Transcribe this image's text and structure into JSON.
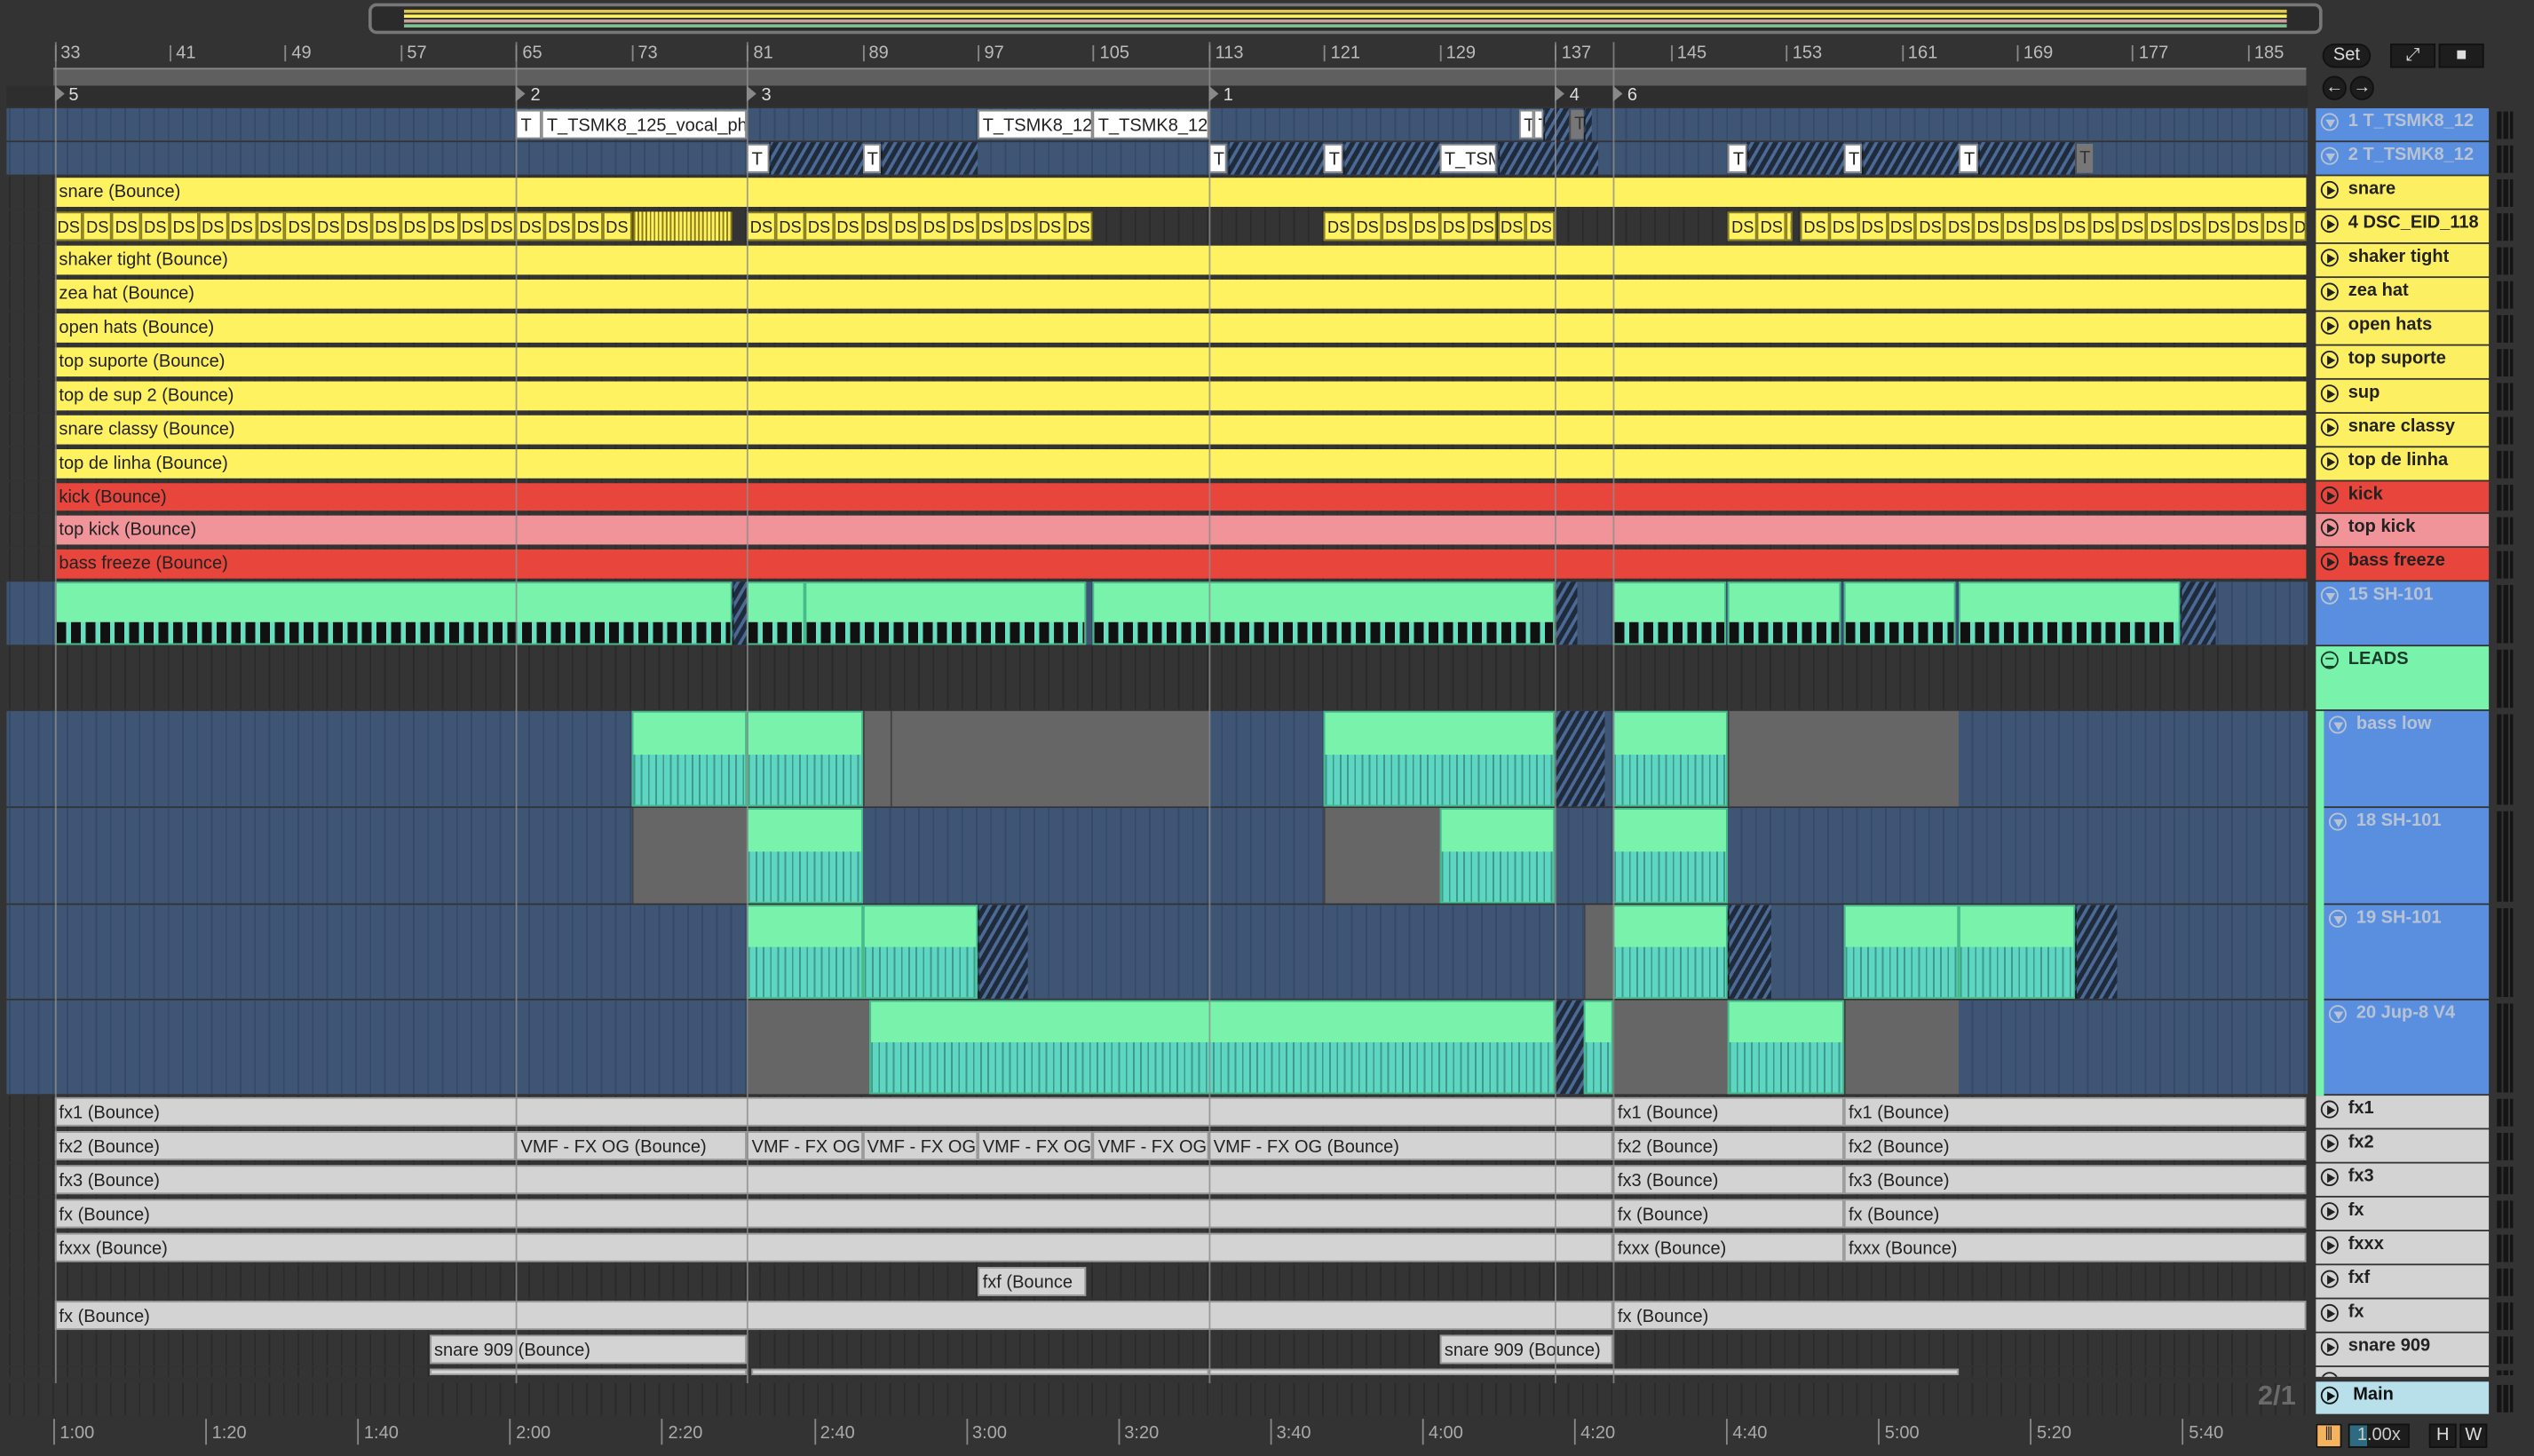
{
  "ruler": {
    "bars": [
      "33",
      "41",
      "49",
      "57",
      "65",
      "73",
      "81",
      "89",
      "97",
      "105",
      "113",
      "121",
      "129",
      "137",
      "145",
      "153",
      "161",
      "169",
      "177",
      "185"
    ]
  },
  "locators": [
    {
      "label": "5",
      "bar": 33
    },
    {
      "label": "2",
      "bar": 65
    },
    {
      "label": "3",
      "bar": 81
    },
    {
      "label": "1",
      "bar": 113
    },
    {
      "label": "4",
      "bar": 137
    },
    {
      "label": "6",
      "bar": 141
    }
  ],
  "controls": {
    "set_label": "Set",
    "back_icon": "arrow-left-icon",
    "forward_icon": "arrow-right-icon",
    "draw_icon": "pencil-draw-icon",
    "lock_icon": "lock-icon",
    "zoom_value": "1.00x",
    "h_label": "H",
    "w_label": "W",
    "signature": "2/1"
  },
  "colors": {
    "yellow": "#fff261",
    "red": "#e8453c",
    "pink": "#f0949a",
    "blue": "#5a8fdf",
    "green": "#79f3ac",
    "light": "#d3d3d3",
    "main": "#b8e0ea"
  },
  "tracks": [
    {
      "header": "1 T_TSMK8_12",
      "icon": "fold",
      "hcolor": "#5a8fdf",
      "htext": "#b7c3d4",
      "lane": "blue",
      "clips": [
        {
          "s": 65,
          "e": 66.8,
          "k": "T",
          "label": "T"
        },
        {
          "s": 66.8,
          "e": 81,
          "k": "T",
          "label": "T_TSMK8_125_vocal_ph"
        },
        {
          "s": 97,
          "e": 105,
          "k": "T",
          "label": "T_TSMK8_12"
        },
        {
          "s": 105,
          "e": 113,
          "k": "T",
          "label": "T_TSMK8_12"
        },
        {
          "s": 134.5,
          "e": 135.5,
          "k": "T",
          "label": "T"
        },
        {
          "s": 135.5,
          "e": 136.2,
          "k": "T",
          "label": "T"
        },
        {
          "s": 136.2,
          "e": 138,
          "k": "hatch",
          "label": ""
        },
        {
          "s": 138,
          "e": 139,
          "k": "Tg",
          "label": "T"
        },
        {
          "s": 139,
          "e": 139.6,
          "k": "hatch",
          "label": ""
        }
      ]
    },
    {
      "header": "2 T_TSMK8_12",
      "icon": "fold",
      "hcolor": "#5a8fdf",
      "htext": "#b7c3d4",
      "lane": "blue",
      "clips": [
        {
          "s": 81,
          "e": 82.5,
          "k": "T",
          "label": "T"
        },
        {
          "s": 82.5,
          "e": 89,
          "k": "hatch",
          "label": ""
        },
        {
          "s": 89,
          "e": 90.3,
          "k": "T",
          "label": "T"
        },
        {
          "s": 90.3,
          "e": 97,
          "k": "hatch",
          "label": ""
        },
        {
          "s": 113,
          "e": 114.3,
          "k": "T",
          "label": "T"
        },
        {
          "s": 114.3,
          "e": 121,
          "k": "hatch",
          "label": ""
        },
        {
          "s": 121,
          "e": 122.3,
          "k": "T",
          "label": "T"
        },
        {
          "s": 122.3,
          "e": 129,
          "k": "hatch",
          "label": ""
        },
        {
          "s": 129,
          "e": 133,
          "k": "T",
          "label": "T_TSM"
        },
        {
          "s": 133,
          "e": 140,
          "k": "hatch",
          "label": ""
        },
        {
          "s": 149,
          "e": 150.3,
          "k": "T",
          "label": "T"
        },
        {
          "s": 150.3,
          "e": 157,
          "k": "hatch",
          "label": ""
        },
        {
          "s": 157,
          "e": 158.3,
          "k": "T",
          "label": "T"
        },
        {
          "s": 158.3,
          "e": 165,
          "k": "hatch",
          "label": ""
        },
        {
          "s": 165,
          "e": 166.3,
          "k": "T",
          "label": "T"
        },
        {
          "s": 166.3,
          "e": 173,
          "k": "hatch",
          "label": ""
        },
        {
          "s": 173,
          "e": 174.3,
          "k": "Tg",
          "label": "T"
        }
      ]
    },
    {
      "header": "snare",
      "icon": "play",
      "hcolor": "#fcef62",
      "htext": "#222",
      "lane": "dark",
      "color": "#fff261",
      "clips": [
        {
          "s": 33,
          "e": 189,
          "k": "audio",
          "label": "snare (Bounce)"
        }
      ]
    },
    {
      "header": "4 DSC_EID_118",
      "icon": "play",
      "hcolor": "#fcef62",
      "htext": "#222",
      "lane": "dark",
      "color": "#fff261",
      "ds": [
        [
          33,
          73
        ],
        [
          81,
          105
        ],
        [
          121,
          137
        ],
        [
          149,
          153.4
        ],
        [
          154,
          189
        ]
      ],
      "ds_label": "DS",
      "clips": [
        {
          "s": 73,
          "e": 80,
          "k": "dense",
          "label": ""
        }
      ]
    },
    {
      "header": "shaker tight",
      "icon": "play",
      "hcolor": "#fcef62",
      "htext": "#222",
      "lane": "dark",
      "color": "#fff261",
      "clips": [
        {
          "s": 33,
          "e": 189,
          "k": "audio",
          "label": "shaker tight (Bounce)"
        }
      ]
    },
    {
      "header": "zea hat",
      "icon": "play",
      "hcolor": "#fcef62",
      "htext": "#222",
      "lane": "dark",
      "color": "#fff261",
      "clips": [
        {
          "s": 33,
          "e": 189,
          "k": "audio",
          "label": "zea hat (Bounce)"
        }
      ]
    },
    {
      "header": "open hats",
      "icon": "play",
      "hcolor": "#fcef62",
      "htext": "#222",
      "lane": "dark",
      "color": "#fff261",
      "clips": [
        {
          "s": 33,
          "e": 189,
          "k": "audio",
          "label": "open hats (Bounce)"
        }
      ]
    },
    {
      "header": "top suporte",
      "icon": "play",
      "hcolor": "#fcef62",
      "htext": "#222",
      "lane": "dark",
      "color": "#fff261",
      "clips": [
        {
          "s": 33,
          "e": 189,
          "k": "audio",
          "label": "top suporte (Bounce)"
        }
      ]
    },
    {
      "header": "sup",
      "icon": "play",
      "hcolor": "#fcef62",
      "htext": "#222",
      "lane": "dark",
      "color": "#fff261",
      "clips": [
        {
          "s": 33,
          "e": 189,
          "k": "audio",
          "label": "top de sup 2 (Bounce)"
        }
      ]
    },
    {
      "header": "snare classy",
      "icon": "play",
      "hcolor": "#fcef62",
      "htext": "#222",
      "lane": "dark",
      "color": "#fff261",
      "clips": [
        {
          "s": 33,
          "e": 189,
          "k": "audio",
          "label": "snare classy (Bounce)"
        }
      ]
    },
    {
      "header": "top de linha",
      "icon": "play",
      "hcolor": "#fcef62",
      "htext": "#222",
      "lane": "dark",
      "color": "#fff261",
      "clips": [
        {
          "s": 33,
          "e": 189,
          "k": "audio",
          "label": "top de linha (Bounce)"
        }
      ]
    },
    {
      "header": "kick",
      "icon": "play",
      "hcolor": "#e8453c",
      "htext": "#222",
      "lane": "dark",
      "color": "#e8453c",
      "clips": [
        {
          "s": 33,
          "e": 189,
          "k": "audio",
          "label": "kick (Bounce)"
        }
      ]
    },
    {
      "header": "top kick",
      "icon": "play",
      "hcolor": "#f0949a",
      "htext": "#222",
      "lane": "dark",
      "color": "#f0949a",
      "clips": [
        {
          "s": 33,
          "e": 189,
          "k": "audio",
          "label": "top kick (Bounce)"
        }
      ]
    },
    {
      "header": "bass freeze",
      "icon": "play",
      "hcolor": "#e8453c",
      "htext": "#222",
      "lane": "dark",
      "color": "#e8453c",
      "clips": [
        {
          "s": 33,
          "e": 189,
          "k": "audio",
          "label": "bass freeze (Bounce)"
        }
      ]
    },
    {
      "header": "15 SH-101",
      "icon": "fold",
      "hcolor": "#5a8fdf",
      "htext": "#b7c3d4",
      "lane": "blue",
      "clips": [
        {
          "s": 33,
          "e": 80,
          "k": "midi thin",
          "label": ""
        },
        {
          "s": 80,
          "e": 81,
          "k": "hatch",
          "label": ""
        },
        {
          "s": 81,
          "e": 85,
          "k": "midi thin",
          "label": ""
        },
        {
          "s": 85,
          "e": 104.5,
          "k": "midi thin",
          "label": ""
        },
        {
          "s": 105,
          "e": 137,
          "k": "midi thin",
          "label": ""
        },
        {
          "s": 137,
          "e": 138.5,
          "k": "hatch",
          "label": ""
        },
        {
          "s": 141,
          "e": 148.8,
          "k": "midi thin",
          "label": ""
        },
        {
          "s": 149,
          "e": 156.8,
          "k": "midi thin",
          "label": ""
        },
        {
          "s": 157,
          "e": 164.8,
          "k": "midi thin",
          "label": ""
        },
        {
          "s": 165,
          "e": 180.3,
          "k": "midi thin",
          "label": ""
        },
        {
          "s": 180.3,
          "e": 182.8,
          "k": "hatch",
          "label": ""
        }
      ]
    },
    {
      "header": "LEADS",
      "icon": "group",
      "hcolor": "#79f3ac",
      "htext": "#1c3a2a",
      "lane": "dark",
      "clips": []
    },
    {
      "header": "bass low",
      "icon": "fold",
      "hcolor": "#5a8fdf",
      "htext": "#b7c3d4",
      "lane": "blue",
      "indent": true,
      "clips": [
        {
          "s": 73,
          "e": 81,
          "k": "midi",
          "label": ""
        },
        {
          "s": 81,
          "e": 89,
          "k": "midi",
          "label": ""
        },
        {
          "s": 89,
          "e": 91,
          "k": "gray",
          "label": ""
        },
        {
          "s": 91,
          "e": 113,
          "k": "gray",
          "label": ""
        },
        {
          "s": 121,
          "e": 137,
          "k": "midi",
          "label": ""
        },
        {
          "s": 137,
          "e": 140.5,
          "k": "hatch",
          "label": ""
        },
        {
          "s": 141,
          "e": 149,
          "k": "midi",
          "label": ""
        },
        {
          "s": 149,
          "e": 165,
          "k": "gray",
          "label": ""
        }
      ]
    },
    {
      "header": "18 SH-101",
      "icon": "fold",
      "hcolor": "#5a8fdf",
      "htext": "#b7c3d4",
      "lane": "blue",
      "indent": true,
      "clips": [
        {
          "s": 73,
          "e": 81,
          "k": "gray",
          "label": ""
        },
        {
          "s": 81,
          "e": 89,
          "k": "midi",
          "label": ""
        },
        {
          "s": 121,
          "e": 129,
          "k": "gray",
          "label": ""
        },
        {
          "s": 129,
          "e": 137,
          "k": "midi",
          "label": ""
        },
        {
          "s": 141,
          "e": 149,
          "k": "midi",
          "label": ""
        }
      ]
    },
    {
      "header": "19 SH-101",
      "icon": "fold",
      "hcolor": "#5a8fdf",
      "htext": "#b7c3d4",
      "lane": "blue",
      "indent": true,
      "clips": [
        {
          "s": 81,
          "e": 89,
          "k": "midi",
          "label": ""
        },
        {
          "s": 89,
          "e": 97,
          "k": "midi",
          "label": ""
        },
        {
          "s": 97,
          "e": 100.5,
          "k": "hatch",
          "label": ""
        },
        {
          "s": 139,
          "e": 141,
          "k": "gray",
          "label": ""
        },
        {
          "s": 141,
          "e": 149,
          "k": "midi",
          "label": ""
        },
        {
          "s": 149,
          "e": 152,
          "k": "hatch",
          "label": ""
        },
        {
          "s": 157,
          "e": 165,
          "k": "midi",
          "label": ""
        },
        {
          "s": 165,
          "e": 173,
          "k": "midi",
          "label": ""
        },
        {
          "s": 173,
          "e": 176,
          "k": "hatch",
          "label": ""
        }
      ]
    },
    {
      "header": "20 Jup-8 V4",
      "icon": "fold",
      "hcolor": "#5a8fdf",
      "htext": "#b7c3d4",
      "lane": "blue",
      "indent": true,
      "clips": [
        {
          "s": 81,
          "e": 89.5,
          "k": "gray",
          "label": ""
        },
        {
          "s": 89.5,
          "e": 137,
          "k": "midi",
          "label": ""
        },
        {
          "s": 137,
          "e": 139,
          "k": "hatch",
          "label": ""
        },
        {
          "s": 139,
          "e": 141,
          "k": "midi",
          "label": ""
        },
        {
          "s": 141,
          "e": 149,
          "k": "gray",
          "label": ""
        },
        {
          "s": 149,
          "e": 157,
          "k": "midi",
          "label": ""
        },
        {
          "s": 157,
          "e": 165,
          "k": "gray",
          "label": ""
        }
      ]
    },
    {
      "header": "fx1",
      "icon": "play",
      "hcolor": "#d3d3d3",
      "htext": "#222",
      "lane": "dark",
      "clips": [
        {
          "s": 33,
          "e": 141,
          "k": "light",
          "label": "fx1 (Bounce)"
        },
        {
          "s": 141,
          "e": 157,
          "k": "light",
          "label": "fx1 (Bounce)"
        },
        {
          "s": 157,
          "e": 189,
          "k": "light",
          "label": "fx1 (Bounce)"
        }
      ]
    },
    {
      "header": "fx2",
      "icon": "play",
      "hcolor": "#d3d3d3",
      "htext": "#222",
      "lane": "dark",
      "clips": [
        {
          "s": 33,
          "e": 65,
          "k": "light",
          "label": "fx2 (Bounce)"
        },
        {
          "s": 65,
          "e": 81,
          "k": "light",
          "label": "VMF -  FX OG (Bounce)"
        },
        {
          "s": 81,
          "e": 89,
          "k": "light",
          "label": "VMF -  FX OG"
        },
        {
          "s": 89,
          "e": 97,
          "k": "light",
          "label": "VMF -  FX OG"
        },
        {
          "s": 97,
          "e": 105,
          "k": "light",
          "label": "VMF -  FX OG"
        },
        {
          "s": 105,
          "e": 113,
          "k": "light",
          "label": "VMF -  FX OG"
        },
        {
          "s": 113,
          "e": 141,
          "k": "light",
          "label": "VMF -  FX OG (Bounce)"
        },
        {
          "s": 141,
          "e": 157,
          "k": "light",
          "label": "fx2 (Bounce)"
        },
        {
          "s": 157,
          "e": 189,
          "k": "light",
          "label": "fx2 (Bounce)"
        }
      ]
    },
    {
      "header": "fx3",
      "icon": "play",
      "hcolor": "#d3d3d3",
      "htext": "#222",
      "lane": "dark",
      "clips": [
        {
          "s": 33,
          "e": 141,
          "k": "light",
          "label": "fx3 (Bounce)"
        },
        {
          "s": 141,
          "e": 157,
          "k": "light",
          "label": "fx3 (Bounce)"
        },
        {
          "s": 157,
          "e": 189,
          "k": "light",
          "label": "fx3 (Bounce)"
        }
      ]
    },
    {
      "header": "fx",
      "icon": "play",
      "hcolor": "#d3d3d3",
      "htext": "#222",
      "lane": "dark",
      "clips": [
        {
          "s": 33,
          "e": 141,
          "k": "light",
          "label": "fx (Bounce)"
        },
        {
          "s": 141,
          "e": 157,
          "k": "light",
          "label": "fx (Bounce)"
        },
        {
          "s": 157,
          "e": 189,
          "k": "light",
          "label": "fx (Bounce)"
        }
      ]
    },
    {
      "header": "fxxx",
      "icon": "play",
      "hcolor": "#d3d3d3",
      "htext": "#222",
      "lane": "dark",
      "clips": [
        {
          "s": 33,
          "e": 141,
          "k": "light",
          "label": "fxxx (Bounce)"
        },
        {
          "s": 141,
          "e": 157,
          "k": "light",
          "label": "fxxx (Bounce)"
        },
        {
          "s": 157,
          "e": 189,
          "k": "light",
          "label": "fxxx (Bounce)"
        }
      ]
    },
    {
      "header": "fxf",
      "icon": "play",
      "hcolor": "#d3d3d3",
      "htext": "#222",
      "lane": "dark",
      "clips": [
        {
          "s": 97,
          "e": 104.5,
          "k": "light",
          "label": "fxf (Bounce"
        }
      ]
    },
    {
      "header": "fx",
      "icon": "play",
      "hcolor": "#d3d3d3",
      "htext": "#222",
      "lane": "dark",
      "clips": [
        {
          "s": 33,
          "e": 141,
          "k": "light",
          "label": "fx (Bounce)"
        },
        {
          "s": 141,
          "e": 189,
          "k": "light",
          "label": "fx (Bounce)"
        }
      ]
    },
    {
      "header": "snare 909",
      "icon": "play",
      "hcolor": "#d3d3d3",
      "htext": "#222",
      "lane": "dark",
      "clips": [
        {
          "s": 59,
          "e": 81,
          "k": "light",
          "label": "snare 909 (Bounce)"
        },
        {
          "s": 129,
          "e": 141,
          "k": "light",
          "label": "snare 909 (Bounce)"
        }
      ]
    },
    {
      "header": "",
      "icon": "play",
      "hcolor": "#d3d3d3",
      "htext": "#222",
      "lane": "dark",
      "clips": [
        {
          "s": 59,
          "e": 81,
          "k": "light",
          "label": ""
        },
        {
          "s": 81.3,
          "e": 113,
          "k": "light",
          "label": ""
        },
        {
          "s": 113,
          "e": 165,
          "k": "light",
          "label": ""
        }
      ]
    }
  ],
  "main": {
    "header": "Main"
  },
  "time_ruler": [
    "1:00",
    "1:20",
    "1:40",
    "2:00",
    "2:20",
    "2:40",
    "3:00",
    "3:20",
    "3:40",
    "4:00",
    "4:20",
    "4:40",
    "5:00",
    "5:20",
    "5:40"
  ]
}
